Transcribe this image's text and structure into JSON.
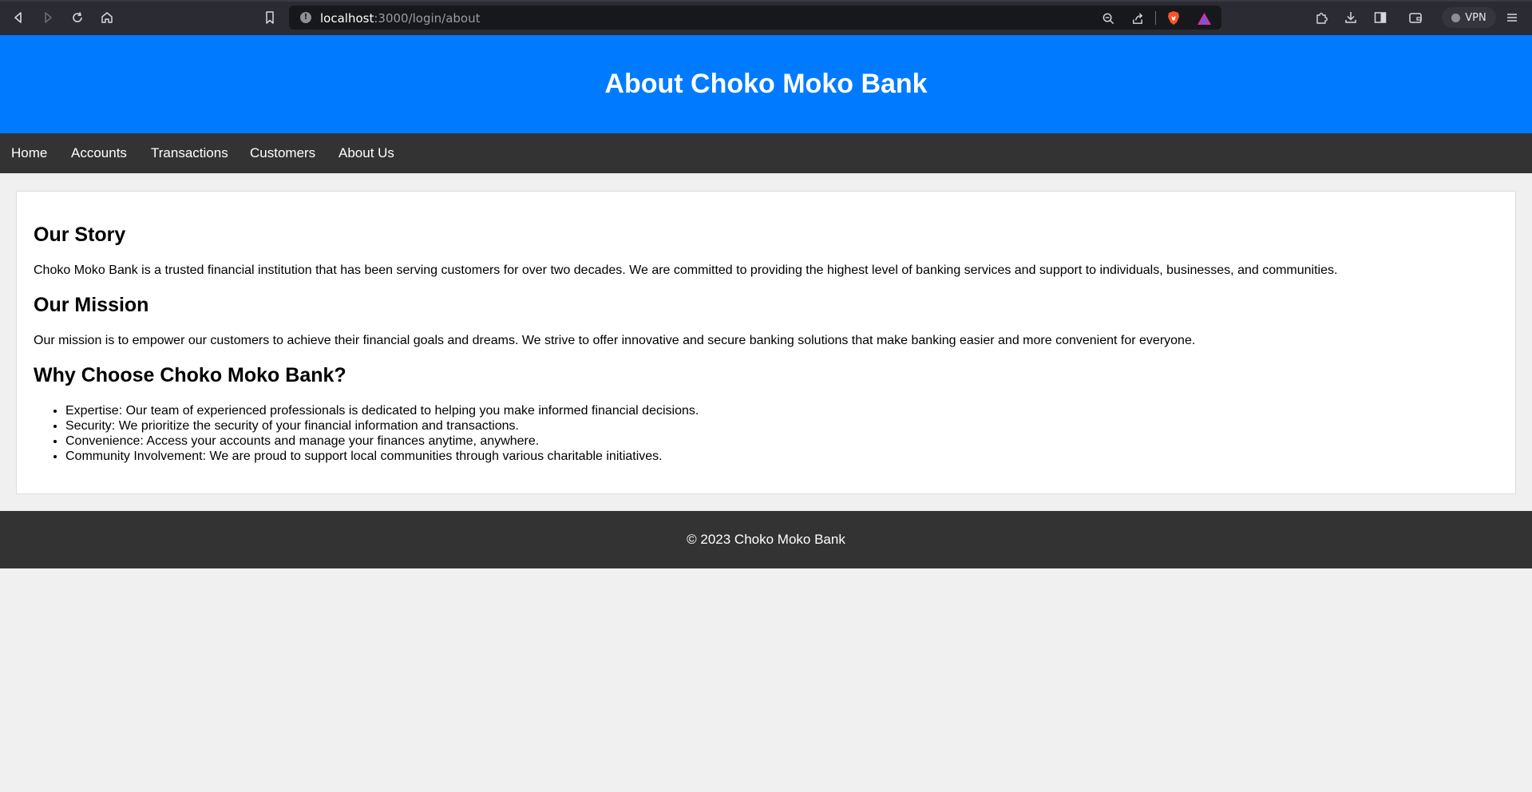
{
  "browser": {
    "url_host": "localhost",
    "url_path": ":3000/login/about",
    "vpn_label": "VPN"
  },
  "header": {
    "title": "About Choko Moko Bank"
  },
  "nav": {
    "items": [
      {
        "label": "Home"
      },
      {
        "label": "Accounts"
      },
      {
        "label": "Transactions"
      },
      {
        "label": "Customers"
      },
      {
        "label": "About Us"
      }
    ]
  },
  "content": {
    "story_heading": "Our Story",
    "story_text": "Choko Moko Bank is a trusted financial institution that has been serving customers for over two decades. We are committed to providing the highest level of banking services and support to individuals, businesses, and communities.",
    "mission_heading": "Our Mission",
    "mission_text": "Our mission is to empower our customers to achieve their financial goals and dreams. We strive to offer innovative and secure banking solutions that make banking easier and more convenient for everyone.",
    "why_heading": "Why Choose Choko Moko Bank?",
    "reasons": [
      "Expertise: Our team of experienced professionals is dedicated to helping you make informed financial decisions.",
      "Security: We prioritize the security of your financial information and transactions.",
      "Convenience: Access your accounts and manage your finances anytime, anywhere.",
      "Community Involvement: We are proud to support local communities through various charitable initiatives."
    ]
  },
  "footer": {
    "copyright": "© 2023 Choko Moko Bank"
  },
  "colors": {
    "header_bg": "#007bff",
    "nav_bg": "#333333",
    "page_bg": "#f0f0f0",
    "browser_bg": "#2b2c33"
  }
}
